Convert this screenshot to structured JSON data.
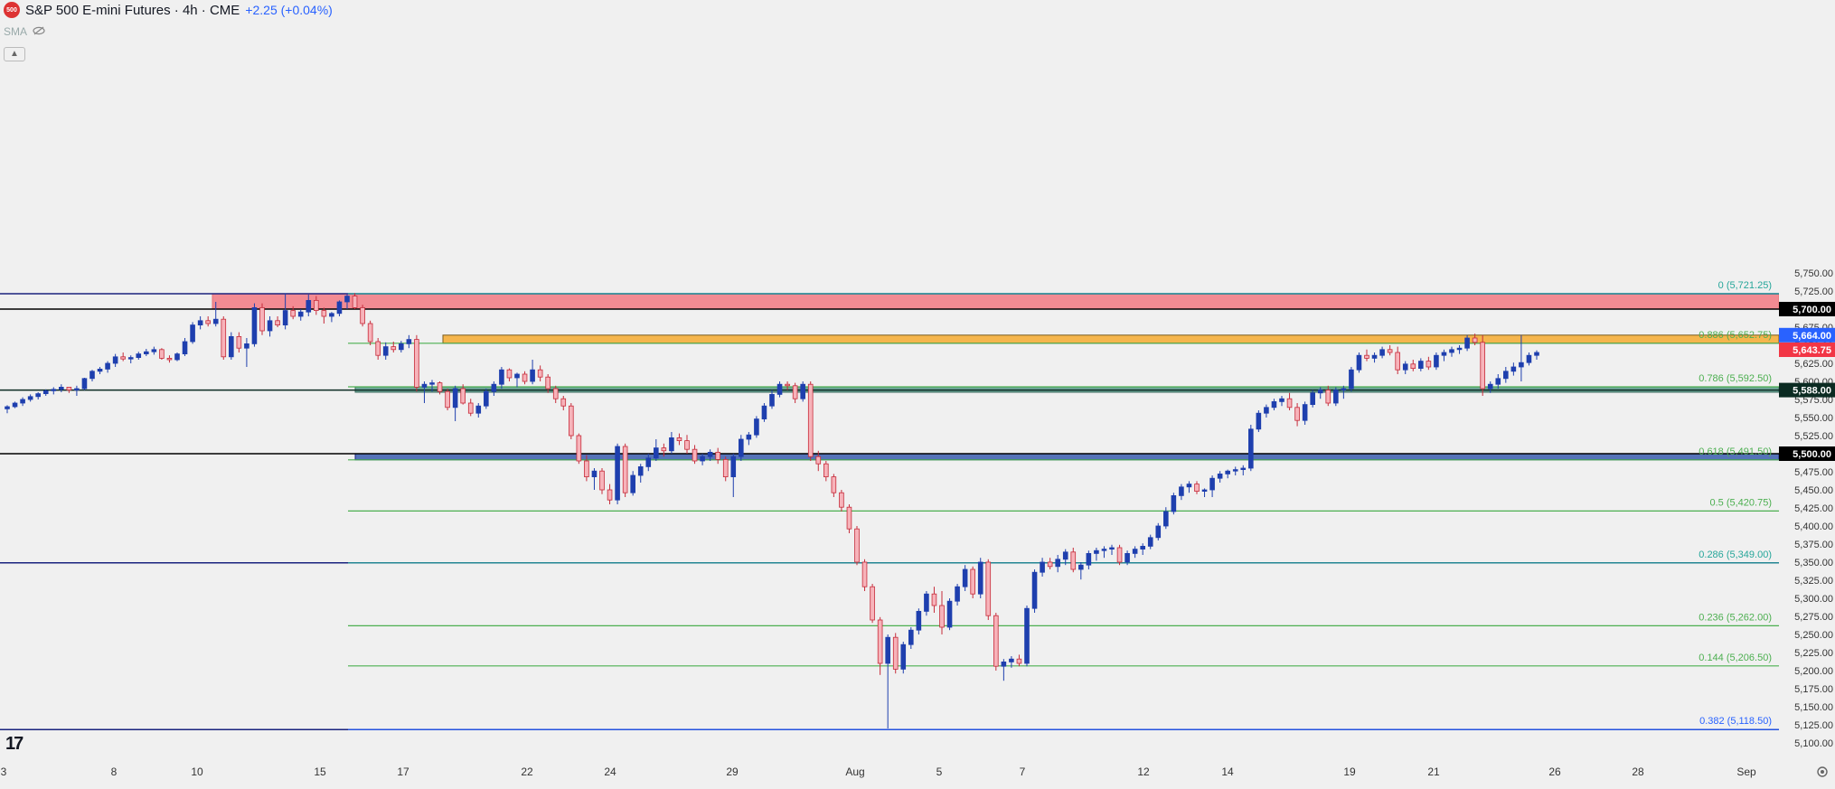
{
  "header": {
    "logo_text": "500",
    "title": "S&P 500 E-mini Futures · 4h · CME",
    "change": "+2.25 (+0.04%)",
    "indicator": "SMA"
  },
  "chart_data": {
    "type": "candlestick",
    "title": "S&P 500 E-mini Futures · 4h · CME",
    "price_axis": {
      "min": 5100,
      "max": 5750,
      "step": 25,
      "ticks": [
        "5,100.00",
        "5,125.00",
        "5,150.00",
        "5,175.00",
        "5,200.00",
        "5,225.00",
        "5,250.00",
        "5,275.00",
        "5,300.00",
        "5,325.00",
        "5,350.00",
        "5,375.00",
        "5,400.00",
        "5,425.00",
        "5,450.00",
        "5,475.00",
        "5,500.00",
        "5,525.00",
        "5,550.00",
        "5,575.00",
        "5,600.00",
        "5,625.00",
        "5,650.00",
        "5,675.00",
        "5,700.00",
        "5,725.00",
        "5,750.00"
      ]
    },
    "time_axis": [
      "3",
      "8",
      "10",
      "15",
      "17",
      "22",
      "24",
      "29",
      "Aug",
      "5",
      "7",
      "12",
      "14",
      "19",
      "21",
      "26",
      "28",
      "Sep"
    ],
    "price_labels": [
      {
        "value": 5700,
        "text": "5,700.00",
        "bg": "#000000",
        "fg": "#ffffff"
      },
      {
        "value": 5664,
        "text": "5,664.00",
        "bg": "#2962ff",
        "fg": "#ffffff"
      },
      {
        "value": 5643.75,
        "text": "5,643.75",
        "bg": "#f23645",
        "fg": "#ffffff"
      },
      {
        "value": 5588,
        "text": "5,588.00",
        "bg": "#0b2b22",
        "fg": "#ffffff"
      },
      {
        "value": 5500,
        "text": "5,500.00",
        "bg": "#000000",
        "fg": "#ffffff"
      }
    ],
    "fibonacci": [
      {
        "level": "0",
        "price": "5,721.25",
        "value": 5721.25,
        "label": "0 (5,721.25)",
        "color": "#26a69a"
      },
      {
        "level": "0.886",
        "price": "5,652.75",
        "value": 5652.75,
        "label": "0.886 (5,652.75)",
        "color": "#4caf50"
      },
      {
        "level": "0.786",
        "price": "5,592.50",
        "value": 5592.5,
        "label": "0.786 (5,592.50)",
        "color": "#4caf50"
      },
      {
        "level": "0.618",
        "price": "5,491.50",
        "value": 5491.5,
        "label": "0.618 (5,491.50)",
        "color": "#4caf50"
      },
      {
        "level": "0.5",
        "price": "5,420.75",
        "value": 5420.75,
        "label": "0.5 (5,420.75)",
        "color": "#4caf50"
      },
      {
        "level": "0.286",
        "price": "5,349.00",
        "value": 5349,
        "label": "0.286 (5,349.00)",
        "color": "#26a69a"
      },
      {
        "level": "0.236",
        "price": "5,262.00",
        "value": 5262,
        "label": "0.236 (5,262.00)",
        "color": "#4caf50"
      },
      {
        "level": "0.144",
        "price": "5,206.50",
        "value": 5206.5,
        "label": "0.144 (5,206.50)",
        "color": "#4caf50"
      },
      {
        "level": "0.382",
        "price": "5,118.50",
        "value": 5118.5,
        "label": "0.382 (5,118.50)",
        "color": "#2962ff"
      }
    ],
    "horizontal_lines": [
      {
        "value": 5700,
        "color": "#000000"
      },
      {
        "value": 5500,
        "color": "#000000"
      },
      {
        "value": 5588,
        "color": "#0b2b22"
      },
      {
        "value": 5721.25,
        "color": "#1a237e"
      },
      {
        "value": 5349,
        "color": "#1a237e"
      },
      {
        "value": 5118.5,
        "color": "#1a237e"
      }
    ],
    "zones": [
      {
        "from": 5700,
        "to": 5721.25,
        "color": "#f28b93",
        "border": "#e57373"
      },
      {
        "from": 5652.75,
        "to": 5664,
        "color": "#f5b54d",
        "border": "#7a5d1e"
      },
      {
        "from": 5588,
        "to": 5592.5,
        "color": "#6fa89a",
        "border": "#3b6d5f"
      },
      {
        "from": 5491.5,
        "to": 5500,
        "color": "#5573b8",
        "border": "#1a237e"
      }
    ],
    "candles": [
      [
        5562,
        5567,
        5556,
        5565
      ],
      [
        5565,
        5572,
        5563,
        5570
      ],
      [
        5570,
        5578,
        5566,
        5575
      ],
      [
        5575,
        5582,
        5572,
        5579
      ],
      [
        5579,
        5585,
        5575,
        5583
      ],
      [
        5583,
        5589,
        5580,
        5587
      ],
      [
        5587,
        5592,
        5582,
        5589
      ],
      [
        5589,
        5596,
        5585,
        5592
      ],
      [
        5592,
        5592,
        5584,
        5588
      ],
      [
        5588,
        5594,
        5580,
        5590
      ],
      [
        5590,
        5605,
        5588,
        5604
      ],
      [
        5604,
        5616,
        5600,
        5614
      ],
      [
        5614,
        5620,
        5610,
        5617
      ],
      [
        5617,
        5628,
        5612,
        5625
      ],
      [
        5625,
        5638,
        5620,
        5634
      ],
      [
        5634,
        5640,
        5628,
        5631
      ],
      [
        5631,
        5636,
        5625,
        5633
      ],
      [
        5633,
        5641,
        5630,
        5638
      ],
      [
        5638,
        5645,
        5635,
        5641
      ],
      [
        5641,
        5648,
        5637,
        5644
      ],
      [
        5644,
        5646,
        5630,
        5632
      ],
      [
        5632,
        5636,
        5626,
        5630
      ],
      [
        5630,
        5640,
        5628,
        5638
      ],
      [
        5638,
        5660,
        5635,
        5655
      ],
      [
        5655,
        5682,
        5652,
        5678
      ],
      [
        5678,
        5690,
        5672,
        5684
      ],
      [
        5684,
        5690,
        5676,
        5680
      ],
      [
        5680,
        5710,
        5676,
        5686
      ],
      [
        5686,
        5690,
        5630,
        5634
      ],
      [
        5634,
        5668,
        5630,
        5662
      ],
      [
        5662,
        5668,
        5640,
        5646
      ],
      [
        5646,
        5660,
        5620,
        5652
      ],
      [
        5652,
        5708,
        5648,
        5702
      ],
      [
        5702,
        5708,
        5664,
        5670
      ],
      [
        5670,
        5690,
        5662,
        5684
      ],
      [
        5684,
        5690,
        5675,
        5678
      ],
      [
        5678,
        5722,
        5672,
        5698
      ],
      [
        5698,
        5704,
        5686,
        5690
      ],
      [
        5690,
        5700,
        5684,
        5696
      ],
      [
        5696,
        5720,
        5690,
        5712
      ],
      [
        5712,
        5718,
        5692,
        5698
      ],
      [
        5698,
        5702,
        5680,
        5690
      ],
      [
        5690,
        5696,
        5682,
        5694
      ],
      [
        5694,
        5712,
        5690,
        5710
      ],
      [
        5710,
        5722,
        5700,
        5718
      ],
      [
        5718,
        5722,
        5700,
        5702
      ],
      [
        5702,
        5706,
        5676,
        5680
      ],
      [
        5680,
        5684,
        5650,
        5655
      ],
      [
        5655,
        5660,
        5630,
        5636
      ],
      [
        5636,
        5654,
        5630,
        5648
      ],
      [
        5648,
        5655,
        5640,
        5644
      ],
      [
        5644,
        5656,
        5640,
        5652
      ],
      [
        5652,
        5664,
        5646,
        5658
      ],
      [
        5658,
        5664,
        5586,
        5592
      ],
      [
        5592,
        5600,
        5570,
        5596
      ],
      [
        5596,
        5602,
        5586,
        5598
      ],
      [
        5598,
        5600,
        5582,
        5586
      ],
      [
        5586,
        5590,
        5560,
        5564
      ],
      [
        5564,
        5594,
        5545,
        5590
      ],
      [
        5590,
        5596,
        5568,
        5570
      ],
      [
        5570,
        5576,
        5552,
        5556
      ],
      [
        5556,
        5570,
        5550,
        5566
      ],
      [
        5566,
        5590,
        5562,
        5586
      ],
      [
        5586,
        5600,
        5580,
        5596
      ],
      [
        5596,
        5620,
        5590,
        5616
      ],
      [
        5616,
        5618,
        5600,
        5605
      ],
      [
        5605,
        5612,
        5592,
        5610
      ],
      [
        5610,
        5614,
        5596,
        5600
      ],
      [
        5600,
        5630,
        5596,
        5616
      ],
      [
        5616,
        5622,
        5600,
        5606
      ],
      [
        5606,
        5610,
        5584,
        5590
      ],
      [
        5590,
        5594,
        5570,
        5576
      ],
      [
        5576,
        5580,
        5560,
        5566
      ],
      [
        5566,
        5570,
        5520,
        5525
      ],
      [
        5525,
        5528,
        5486,
        5490
      ],
      [
        5490,
        5498,
        5462,
        5468
      ],
      [
        5468,
        5480,
        5450,
        5476
      ],
      [
        5476,
        5480,
        5444,
        5450
      ],
      [
        5450,
        5458,
        5430,
        5436
      ],
      [
        5436,
        5514,
        5430,
        5510
      ],
      [
        5510,
        5514,
        5440,
        5446
      ],
      [
        5446,
        5476,
        5442,
        5470
      ],
      [
        5470,
        5486,
        5460,
        5482
      ],
      [
        5482,
        5500,
        5476,
        5494
      ],
      [
        5494,
        5520,
        5490,
        5508
      ],
      [
        5508,
        5514,
        5496,
        5504
      ],
      [
        5504,
        5530,
        5500,
        5522
      ],
      [
        5522,
        5528,
        5512,
        5518
      ],
      [
        5518,
        5526,
        5500,
        5506
      ],
      [
        5506,
        5512,
        5486,
        5490
      ],
      [
        5490,
        5500,
        5484,
        5496
      ],
      [
        5496,
        5506,
        5490,
        5502
      ],
      [
        5502,
        5508,
        5486,
        5492
      ],
      [
        5492,
        5496,
        5462,
        5468
      ],
      [
        5468,
        5500,
        5440,
        5496
      ],
      [
        5496,
        5526,
        5490,
        5520
      ],
      [
        5520,
        5530,
        5512,
        5526
      ],
      [
        5526,
        5552,
        5522,
        5548
      ],
      [
        5548,
        5570,
        5544,
        5566
      ],
      [
        5566,
        5588,
        5562,
        5582
      ],
      [
        5582,
        5600,
        5578,
        5596
      ],
      [
        5596,
        5600,
        5588,
        5594
      ],
      [
        5594,
        5598,
        5570,
        5576
      ],
      [
        5576,
        5600,
        5572,
        5596
      ],
      [
        5596,
        5600,
        5490,
        5496
      ],
      [
        5496,
        5504,
        5476,
        5486
      ],
      [
        5486,
        5490,
        5462,
        5468
      ],
      [
        5468,
        5472,
        5440,
        5446
      ],
      [
        5446,
        5450,
        5420,
        5426
      ],
      [
        5426,
        5430,
        5390,
        5396
      ],
      [
        5396,
        5400,
        5346,
        5350
      ],
      [
        5350,
        5354,
        5310,
        5316
      ],
      [
        5316,
        5320,
        5266,
        5270
      ],
      [
        5270,
        5274,
        5194,
        5210
      ],
      [
        5210,
        5250,
        5120,
        5246
      ],
      [
        5246,
        5252,
        5196,
        5202
      ],
      [
        5202,
        5240,
        5196,
        5236
      ],
      [
        5236,
        5260,
        5230,
        5256
      ],
      [
        5256,
        5286,
        5250,
        5282
      ],
      [
        5282,
        5310,
        5276,
        5306
      ],
      [
        5306,
        5316,
        5280,
        5290
      ],
      [
        5290,
        5310,
        5250,
        5260
      ],
      [
        5260,
        5300,
        5256,
        5296
      ],
      [
        5296,
        5320,
        5290,
        5316
      ],
      [
        5316,
        5346,
        5310,
        5340
      ],
      [
        5340,
        5344,
        5300,
        5306
      ],
      [
        5306,
        5356,
        5300,
        5350
      ],
      [
        5350,
        5354,
        5270,
        5276
      ],
      [
        5276,
        5280,
        5200,
        5206
      ],
      [
        5206,
        5216,
        5186,
        5212
      ],
      [
        5212,
        5220,
        5204,
        5216
      ],
      [
        5216,
        5222,
        5206,
        5210
      ],
      [
        5210,
        5290,
        5206,
        5286
      ],
      [
        5286,
        5340,
        5280,
        5336
      ],
      [
        5336,
        5356,
        5330,
        5350
      ],
      [
        5350,
        5356,
        5340,
        5344
      ],
      [
        5344,
        5360,
        5336,
        5354
      ],
      [
        5354,
        5368,
        5346,
        5364
      ],
      [
        5364,
        5370,
        5336,
        5340
      ],
      [
        5340,
        5350,
        5326,
        5346
      ],
      [
        5346,
        5366,
        5340,
        5362
      ],
      [
        5362,
        5370,
        5352,
        5366
      ],
      [
        5366,
        5372,
        5356,
        5368
      ],
      [
        5368,
        5374,
        5360,
        5370
      ],
      [
        5370,
        5374,
        5346,
        5350
      ],
      [
        5350,
        5366,
        5346,
        5362
      ],
      [
        5362,
        5372,
        5356,
        5368
      ],
      [
        5368,
        5376,
        5360,
        5372
      ],
      [
        5372,
        5388,
        5368,
        5384
      ],
      [
        5384,
        5404,
        5380,
        5400
      ],
      [
        5400,
        5426,
        5396,
        5420
      ],
      [
        5420,
        5446,
        5416,
        5442
      ],
      [
        5442,
        5458,
        5436,
        5454
      ],
      [
        5454,
        5462,
        5446,
        5458
      ],
      [
        5458,
        5462,
        5444,
        5448
      ],
      [
        5448,
        5452,
        5440,
        5450
      ],
      [
        5450,
        5470,
        5440,
        5466
      ],
      [
        5466,
        5476,
        5460,
        5472
      ],
      [
        5472,
        5478,
        5466,
        5476
      ],
      [
        5476,
        5482,
        5470,
        5478
      ],
      [
        5478,
        5484,
        5470,
        5480
      ],
      [
        5480,
        5540,
        5476,
        5534
      ],
      [
        5534,
        5560,
        5530,
        5556
      ],
      [
        5556,
        5568,
        5550,
        5564
      ],
      [
        5564,
        5576,
        5560,
        5572
      ],
      [
        5572,
        5580,
        5566,
        5576
      ],
      [
        5576,
        5584,
        5560,
        5564
      ],
      [
        5564,
        5570,
        5538,
        5546
      ],
      [
        5546,
        5572,
        5540,
        5568
      ],
      [
        5568,
        5588,
        5564,
        5584
      ],
      [
        5584,
        5592,
        5576,
        5588
      ],
      [
        5588,
        5594,
        5566,
        5570
      ],
      [
        5570,
        5592,
        5566,
        5588
      ],
      [
        5588,
        5594,
        5576,
        5590
      ],
      [
        5590,
        5620,
        5586,
        5616
      ],
      [
        5616,
        5640,
        5612,
        5636
      ],
      [
        5636,
        5644,
        5628,
        5632
      ],
      [
        5632,
        5640,
        5626,
        5636
      ],
      [
        5636,
        5648,
        5632,
        5644
      ],
      [
        5644,
        5650,
        5636,
        5640
      ],
      [
        5640,
        5648,
        5610,
        5616
      ],
      [
        5616,
        5628,
        5610,
        5624
      ],
      [
        5624,
        5630,
        5614,
        5618
      ],
      [
        5618,
        5632,
        5614,
        5628
      ],
      [
        5628,
        5634,
        5616,
        5620
      ],
      [
        5620,
        5640,
        5616,
        5636
      ],
      [
        5636,
        5644,
        5628,
        5640
      ],
      [
        5640,
        5648,
        5634,
        5644
      ],
      [
        5644,
        5650,
        5638,
        5646
      ],
      [
        5646,
        5664,
        5642,
        5660
      ],
      [
        5660,
        5666,
        5650,
        5654
      ],
      [
        5654,
        5664,
        5580,
        5590
      ],
      [
        5590,
        5600,
        5584,
        5596
      ],
      [
        5596,
        5610,
        5590,
        5604
      ],
      [
        5604,
        5620,
        5598,
        5614
      ],
      [
        5614,
        5626,
        5608,
        5620
      ],
      [
        5620,
        5664,
        5600,
        5626
      ],
      [
        5626,
        5640,
        5622,
        5636
      ],
      [
        5636,
        5643,
        5630,
        5640
      ]
    ]
  }
}
